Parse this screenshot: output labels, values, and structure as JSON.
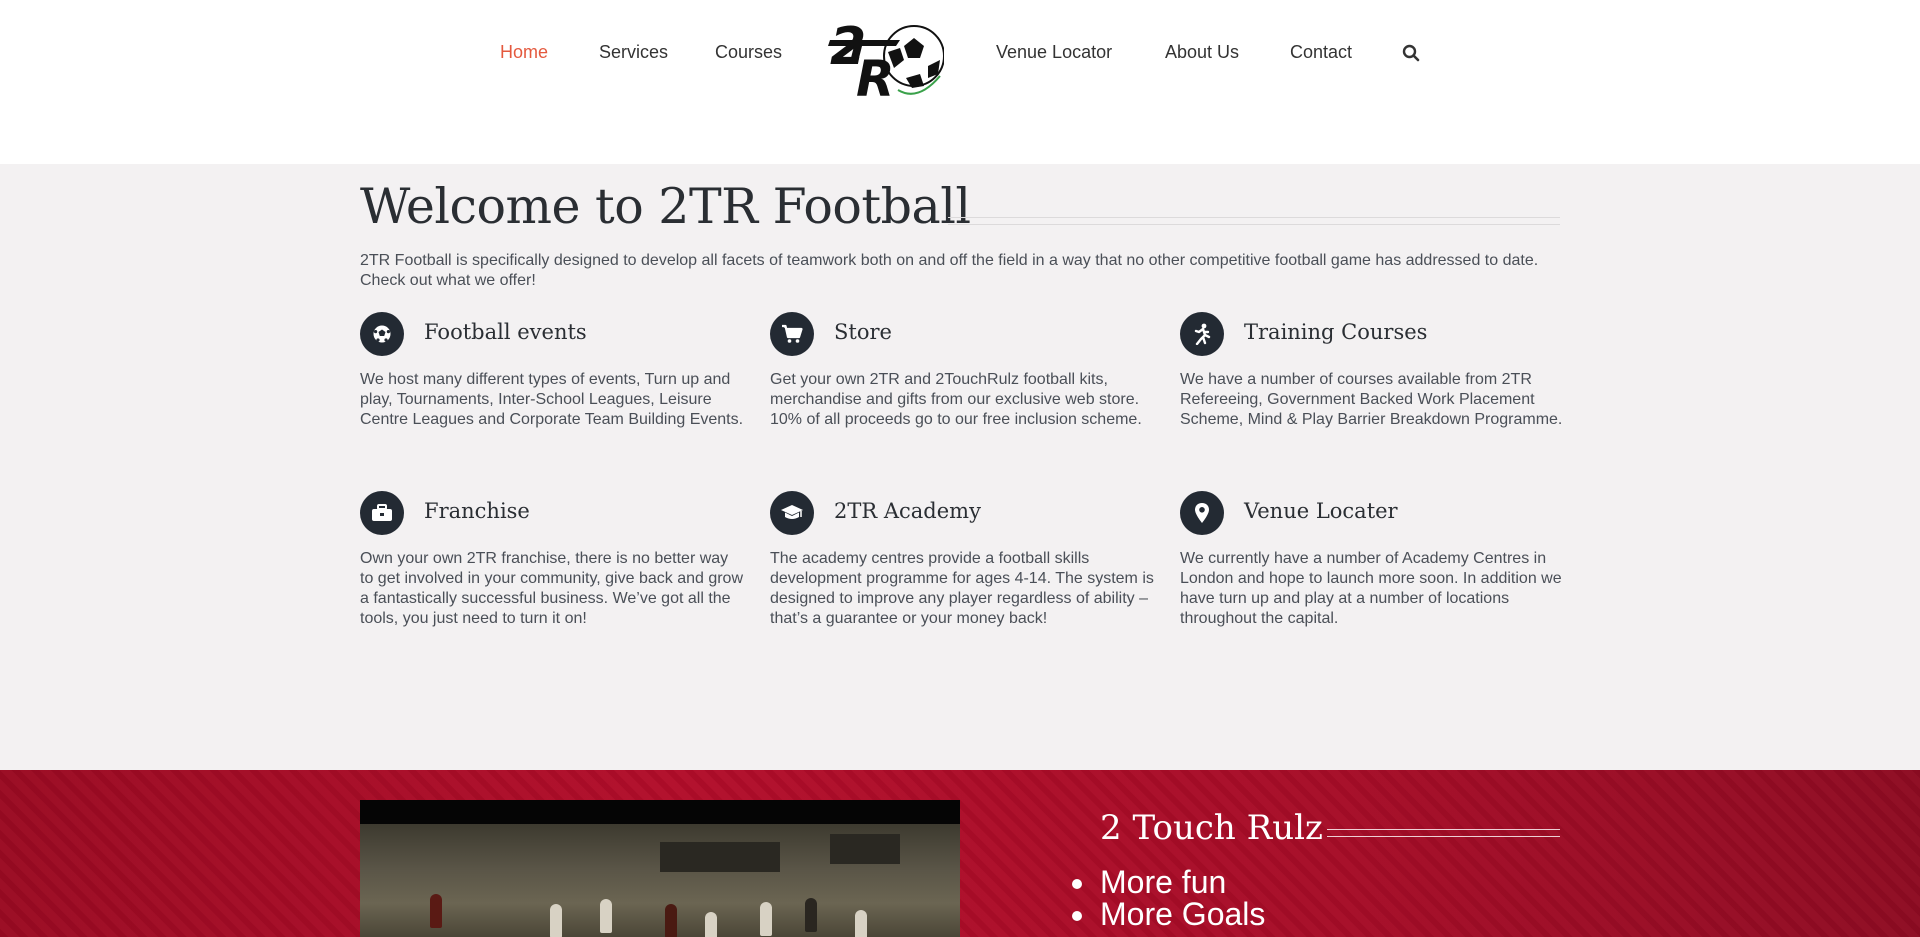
{
  "nav": {
    "items": [
      {
        "label": "Home",
        "active": true
      },
      {
        "label": "Services"
      },
      {
        "label": "Courses"
      },
      {
        "label": "Venue Locator"
      },
      {
        "label": "About Us"
      },
      {
        "label": "Contact"
      }
    ],
    "logo_text": "2TR",
    "search_icon": "search-icon"
  },
  "welcome": {
    "title": "Welcome to 2TR Football",
    "intro": "2TR Football is specifically designed to develop all facets of teamwork both on and off the field in a way that no other competitive football game has addressed to date. Check out what we offer!",
    "features": [
      {
        "icon": "soccer-ball-icon",
        "title": "Football events",
        "desc": "We host many different types of events, Turn up and play, Tournaments, Inter-School Leagues, Leisure Centre Leagues and Corporate Team Building Events."
      },
      {
        "icon": "shopping-cart-icon",
        "title": "Store",
        "desc": "Get your own 2TR and 2TouchRulz football kits, merchandise and gifts from our exclusive web store. 10% of all proceeds go to our free inclusion scheme."
      },
      {
        "icon": "running-person-icon",
        "title": "Training Courses",
        "desc": "We have a number of courses available from 2TR Refereeing, Government Backed Work Placement Scheme, Mind & Play Barrier Breakdown Programme."
      },
      {
        "icon": "briefcase-icon",
        "title": "Franchise",
        "desc": "Own your own 2TR franchise, there is no better way to get involved in your community, give back and grow a fantastically successful business. We’ve got all the tools, you just need to turn it on!"
      },
      {
        "icon": "graduation-cap-icon",
        "title": "2TR Academy",
        "desc": "The academy centres provide a football skills development programme for ages 4-14. The system is designed to improve any player regardless of ability – that’s a guarantee or your money back!"
      },
      {
        "icon": "map-pin-icon",
        "title": "Venue Locater",
        "desc": "We currently have a number of Academy Centres in London and hope to launch more soon. In addition we have turn up and play at a number of locations throughout the capital."
      }
    ]
  },
  "rulz": {
    "title": "2 Touch Rulz",
    "items": [
      "More fun",
      "More Goals"
    ]
  },
  "colors": {
    "accent": "#e4593e",
    "dark": "#232a33",
    "red_band": "#a60c27",
    "bg": "#f3f1f2"
  }
}
